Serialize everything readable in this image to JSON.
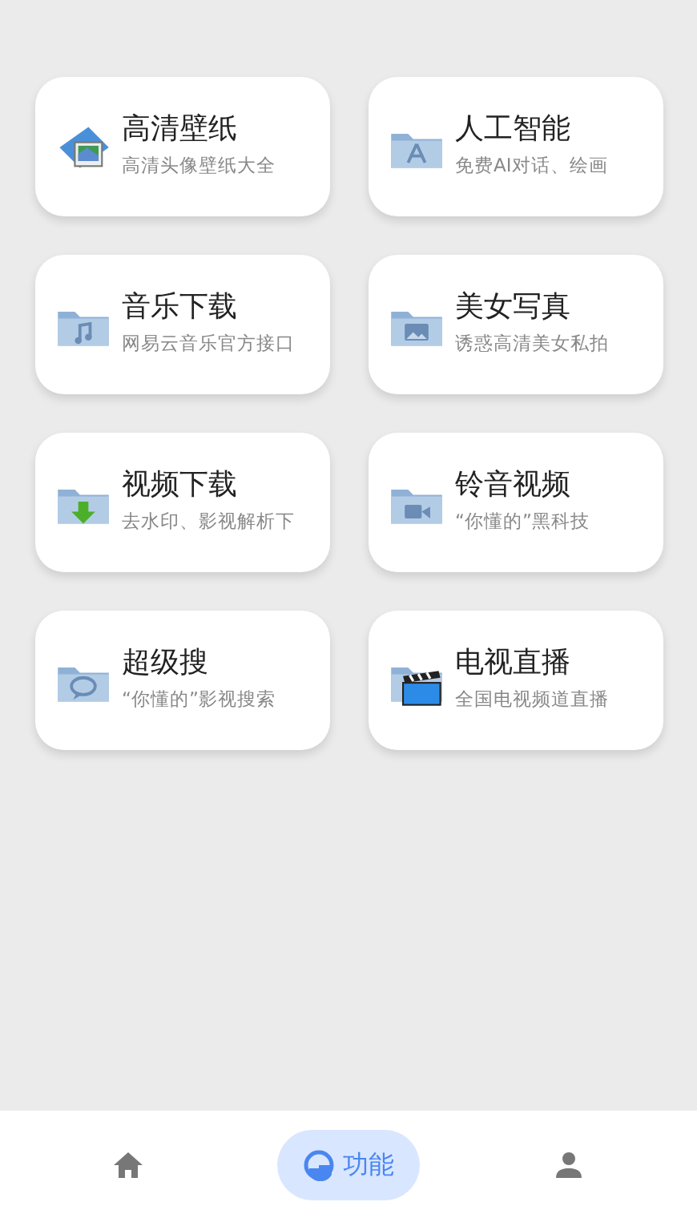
{
  "cards": [
    {
      "kind": "wallpaper",
      "title": "高清壁纸",
      "subtitle": "高清头像壁纸大全"
    },
    {
      "kind": "ai",
      "title": "人工智能",
      "subtitle": "免费AI对话、绘画"
    },
    {
      "kind": "music",
      "title": "音乐下载",
      "subtitle": "网易云音乐官方接口"
    },
    {
      "kind": "photo",
      "title": "美女写真",
      "subtitle": "诱惑高清美女私拍"
    },
    {
      "kind": "download",
      "title": "视频下载",
      "subtitle": "去水印、影视解析下"
    },
    {
      "kind": "video",
      "title": "铃音视频",
      "subtitle": "“你懂的”黑科技"
    },
    {
      "kind": "chat",
      "title": "超级搜",
      "subtitle": "“你懂的”影视搜索"
    },
    {
      "kind": "clapper",
      "title": "电视直播",
      "subtitle": "全国电视频道直播"
    }
  ],
  "nav": [
    {
      "kind": "home",
      "selected": false
    },
    {
      "kind": "function",
      "label": "功能",
      "selected": true
    },
    {
      "kind": "profile",
      "selected": false
    }
  ]
}
